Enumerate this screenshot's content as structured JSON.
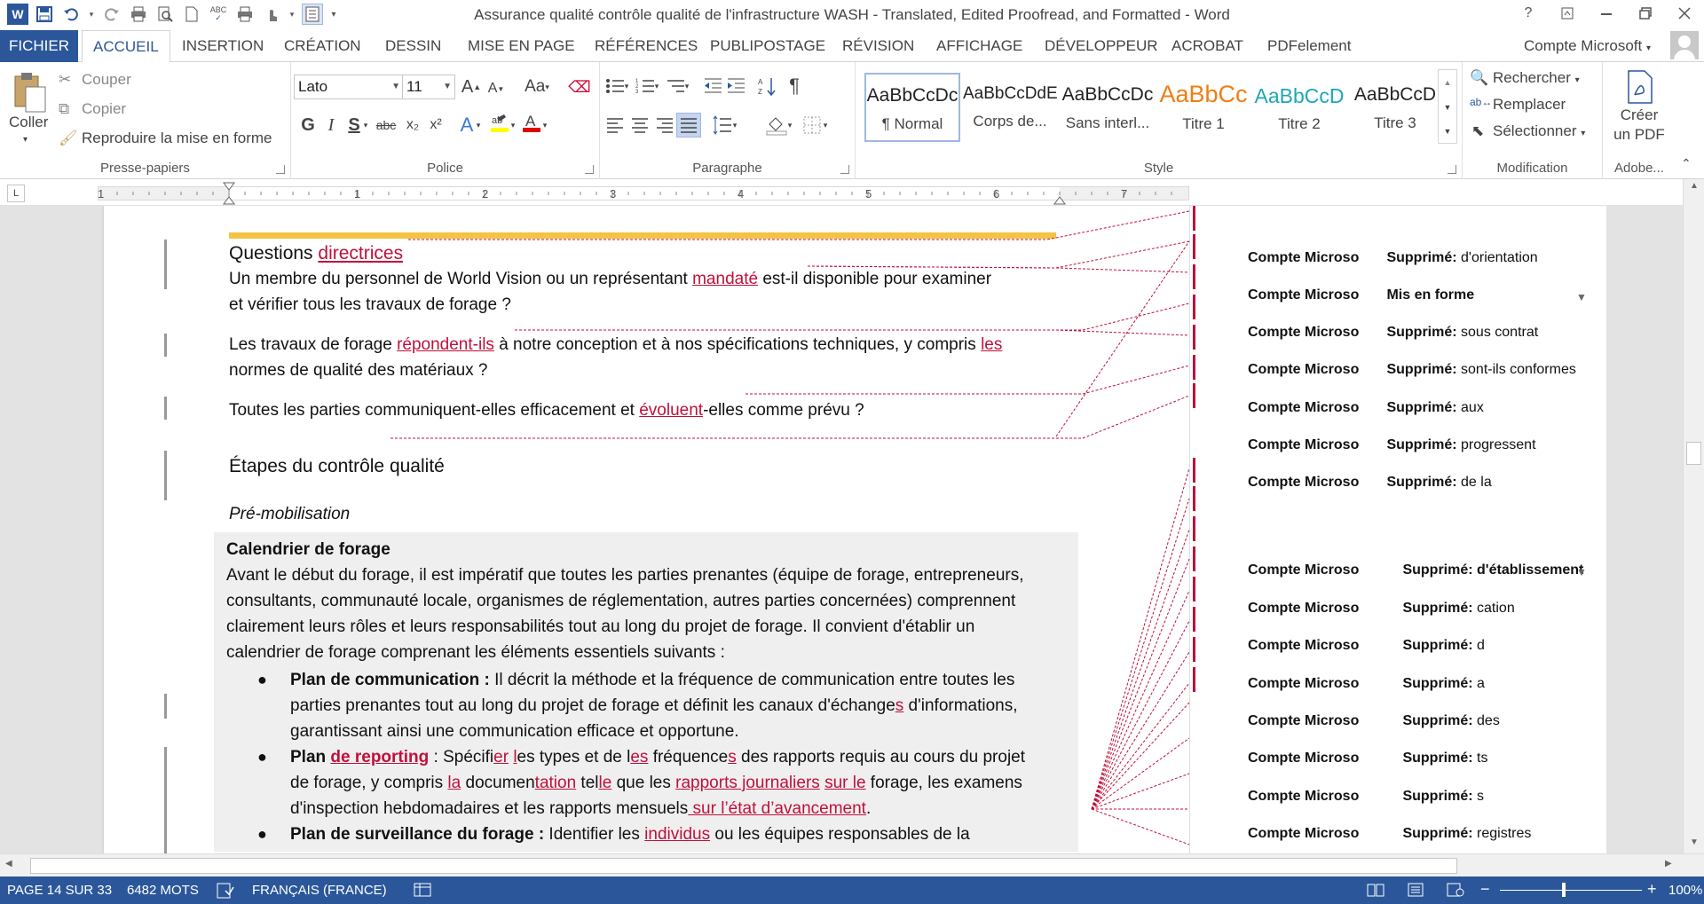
{
  "window": {
    "title": "Assurance qualité  contrôle qualité de l'infrastructure WASH - Translated, Edited Proofread, and Formatted - Word",
    "help": "?",
    "controls": [
      "restore-ribbon",
      "minimize",
      "maximize",
      "close"
    ]
  },
  "qat": [
    "word-logo-icon",
    "save-icon",
    "undo-icon",
    "redo-icon",
    "print-icon",
    "print-preview-icon",
    "new-doc-icon",
    "spelling-icon",
    "quick-print-icon",
    "touch-mode-icon",
    "draw-table-icon",
    "customize-icon"
  ],
  "qat_word": "W",
  "tabs": [
    "FICHIER",
    "ACCUEIL",
    "INSERTION",
    "CRÉATION",
    "DESSIN",
    "MISE EN PAGE",
    "RÉFÉRENCES",
    "PUBLIPOSTAGE",
    "RÉVISION",
    "AFFICHAGE",
    "DÉVELOPPEUR",
    "ACROBAT",
    "PDFelement"
  ],
  "active_tab": "ACCUEIL",
  "account": "Compte Microsoft",
  "clipboard": {
    "paste": "Coller",
    "cut": "Couper",
    "copy": "Copier",
    "format_painter": "Reproduire la mise en forme",
    "label": "Presse-papiers"
  },
  "font": {
    "name": "Lato",
    "size": "11",
    "label": "Police",
    "case": "Aa",
    "bold": "G",
    "italic": "I",
    "underline": "S",
    "strike": "abc",
    "sub": "x₂",
    "sup": "x²"
  },
  "paragraph": {
    "label": "Paragraphe",
    "show_marks": "¶"
  },
  "styles": {
    "label": "Style",
    "items": [
      {
        "sample": "AaBbCcDc",
        "name": "¶ Normal",
        "color": "#222222"
      },
      {
        "sample": "AaBbCcDdE",
        "name": "Corps de...",
        "color": "#222222"
      },
      {
        "sample": "AaBbCcDc",
        "name": "Sans interl...",
        "color": "#222222"
      },
      {
        "sample": "AaBbCc",
        "name": "Titre 1",
        "color": "#f07d14"
      },
      {
        "sample": "AaBbCcD",
        "name": "Titre 2",
        "color": "#1ea6b8"
      },
      {
        "sample": "AaBbCcD",
        "name": "Titre 3",
        "color": "#222222"
      }
    ]
  },
  "editing": {
    "find": "Rechercher",
    "replace": "Remplacer",
    "select": "Sélectionner",
    "label": "Modification"
  },
  "adobe": {
    "create_line1": "Créer",
    "create_line2": "un PDF",
    "label": "Adobe..."
  },
  "ruler_numbers": [
    "1",
    "1",
    "2",
    "3",
    "4",
    "5",
    "6",
    "7"
  ],
  "ruler_tab": "L",
  "document": {
    "heading1_plain": "Questions ",
    "heading1_ins": "directrices",
    "p1_a": "Un membre du personnel de World Vision ou un représentant ",
    "p1_ins": "mandaté",
    "p1_b": " est-il disponible pour examiner",
    "p1_c": "et vérifier tous les travaux de forage ?",
    "p2_a": "Les travaux de forage ",
    "p2_ins1": "répondent-ils",
    "p2_b": " à notre conception et à nos spécifications techniques, y compris ",
    "p2_ins2": "les",
    "p2_c": "normes de qualité des matériaux ?",
    "p3_a": "Toutes les parties communiquent-elles efficacement et ",
    "p3_ins": "évoluent",
    "p3_b": "-elles comme prévu ?",
    "heading2": "Étapes du contrôle qualité",
    "subheading": "Pré-mobilisation",
    "box_title": "Calendrier de forage",
    "box_lines": [
      "Avant le début du forage, il est impératif que toutes les parties prenantes (équipe de forage, entrepreneurs,",
      "consultants, communauté locale, organismes de réglementation, autres parties concernées) comprennent",
      "clairement leurs rôles et leurs responsabilités tout au long du projet de forage. Il convient d'établir un",
      "calendrier de forage comprenant les éléments essentiels suivants :"
    ],
    "b1_bold": "Plan de communication : ",
    "b1_a": "Il décrit la méthode et la fréquence de communication entre toutes les",
    "b1_b1": "parties prenantes tout au long du projet de forage et définit les canaux d'échange",
    "b1_b_ins": "s",
    "b1_b2": " d'informations,",
    "b1_c": "garantissant ainsi une communication efficace et opportune.",
    "b2_bold1": "Plan ",
    "b2_bold_ins": "de reporting",
    "b2_a1": " : Spécifi",
    "b2_ins1": "er",
    "b2_a2": " ",
    "b2_ins2": "l",
    "b2_a3": "es types et de l",
    "b2_ins3": "es",
    "b2_a4": " fréquence",
    "b2_ins4": "s",
    "b2_a5": " des rapports requis au cours du projet",
    "b2_b1": "de forage, y compris ",
    "b2_b_ins1": "la",
    "b2_b2": " documen",
    "b2_b_ins2": "tation",
    "b2_b3": " tel",
    "b2_b_ins3": "le",
    "b2_b4": " que les ",
    "b2_b_ins4": "rapports journaliers",
    "b2_b5": " ",
    "b2_b_ins5": "sur le",
    "b2_b6": " forage, les examens",
    "b2_c1": "d'inspection hebdomadaires et les rapports mensuels",
    "b2_c_ins": " sur l’état d’avancement",
    "b2_c2": ".",
    "b3_bold": "Plan de surveillance du forage : ",
    "b3_a": "Identifier les ",
    "b3_ins": "individus",
    "b3_b": " ou les équipes responsables de la"
  },
  "revisions": [
    {
      "author": "Compte Microso",
      "action": "Supprimé:",
      "text": " d'orientation"
    },
    {
      "author": "Compte Microso",
      "action": "Mis en forme",
      "text": ""
    },
    {
      "author": "Compte Microso",
      "action": "Supprimé:",
      "text": " sous contrat"
    },
    {
      "author": "Compte Microso",
      "action": "Supprimé:",
      "text": " sont-ils conformes"
    },
    {
      "author": "Compte Microso",
      "action": "Supprimé:",
      "text": " aux"
    },
    {
      "author": "Compte Microso",
      "action": "Supprimé:",
      "text": " progressent"
    },
    {
      "author": "Compte Microso",
      "action": "Supprimé:",
      "text": "  de la"
    },
    {
      "author": "Compte Microso",
      "action": "Supprimé:",
      "text": " d'établissement"
    },
    {
      "author": "Compte Microso",
      "action": "Supprimé:",
      "text": " cation"
    },
    {
      "author": "Compte Microso",
      "action": "Supprimé:",
      "text": " d"
    },
    {
      "author": "Compte Microso",
      "action": "Supprimé:",
      "text": " a"
    },
    {
      "author": "Compte Microso",
      "action": "Supprimé:",
      "text": " des"
    },
    {
      "author": "Compte Microso",
      "action": "Supprimé:",
      "text": " ts"
    },
    {
      "author": "Compte Microso",
      "action": "Supprimé:",
      "text": " s"
    },
    {
      "author": "Compte Microso",
      "action": "Supprimé:",
      "text": " registres"
    }
  ],
  "status": {
    "page": "PAGE 14 SUR 33",
    "words": "6482 MOTS",
    "language": "FRANÇAIS (FRANCE)",
    "zoom": "100%"
  },
  "colors": {
    "accent": "#2b579a",
    "revision": "#c0103a",
    "highlight_bar": "#f5c243"
  }
}
